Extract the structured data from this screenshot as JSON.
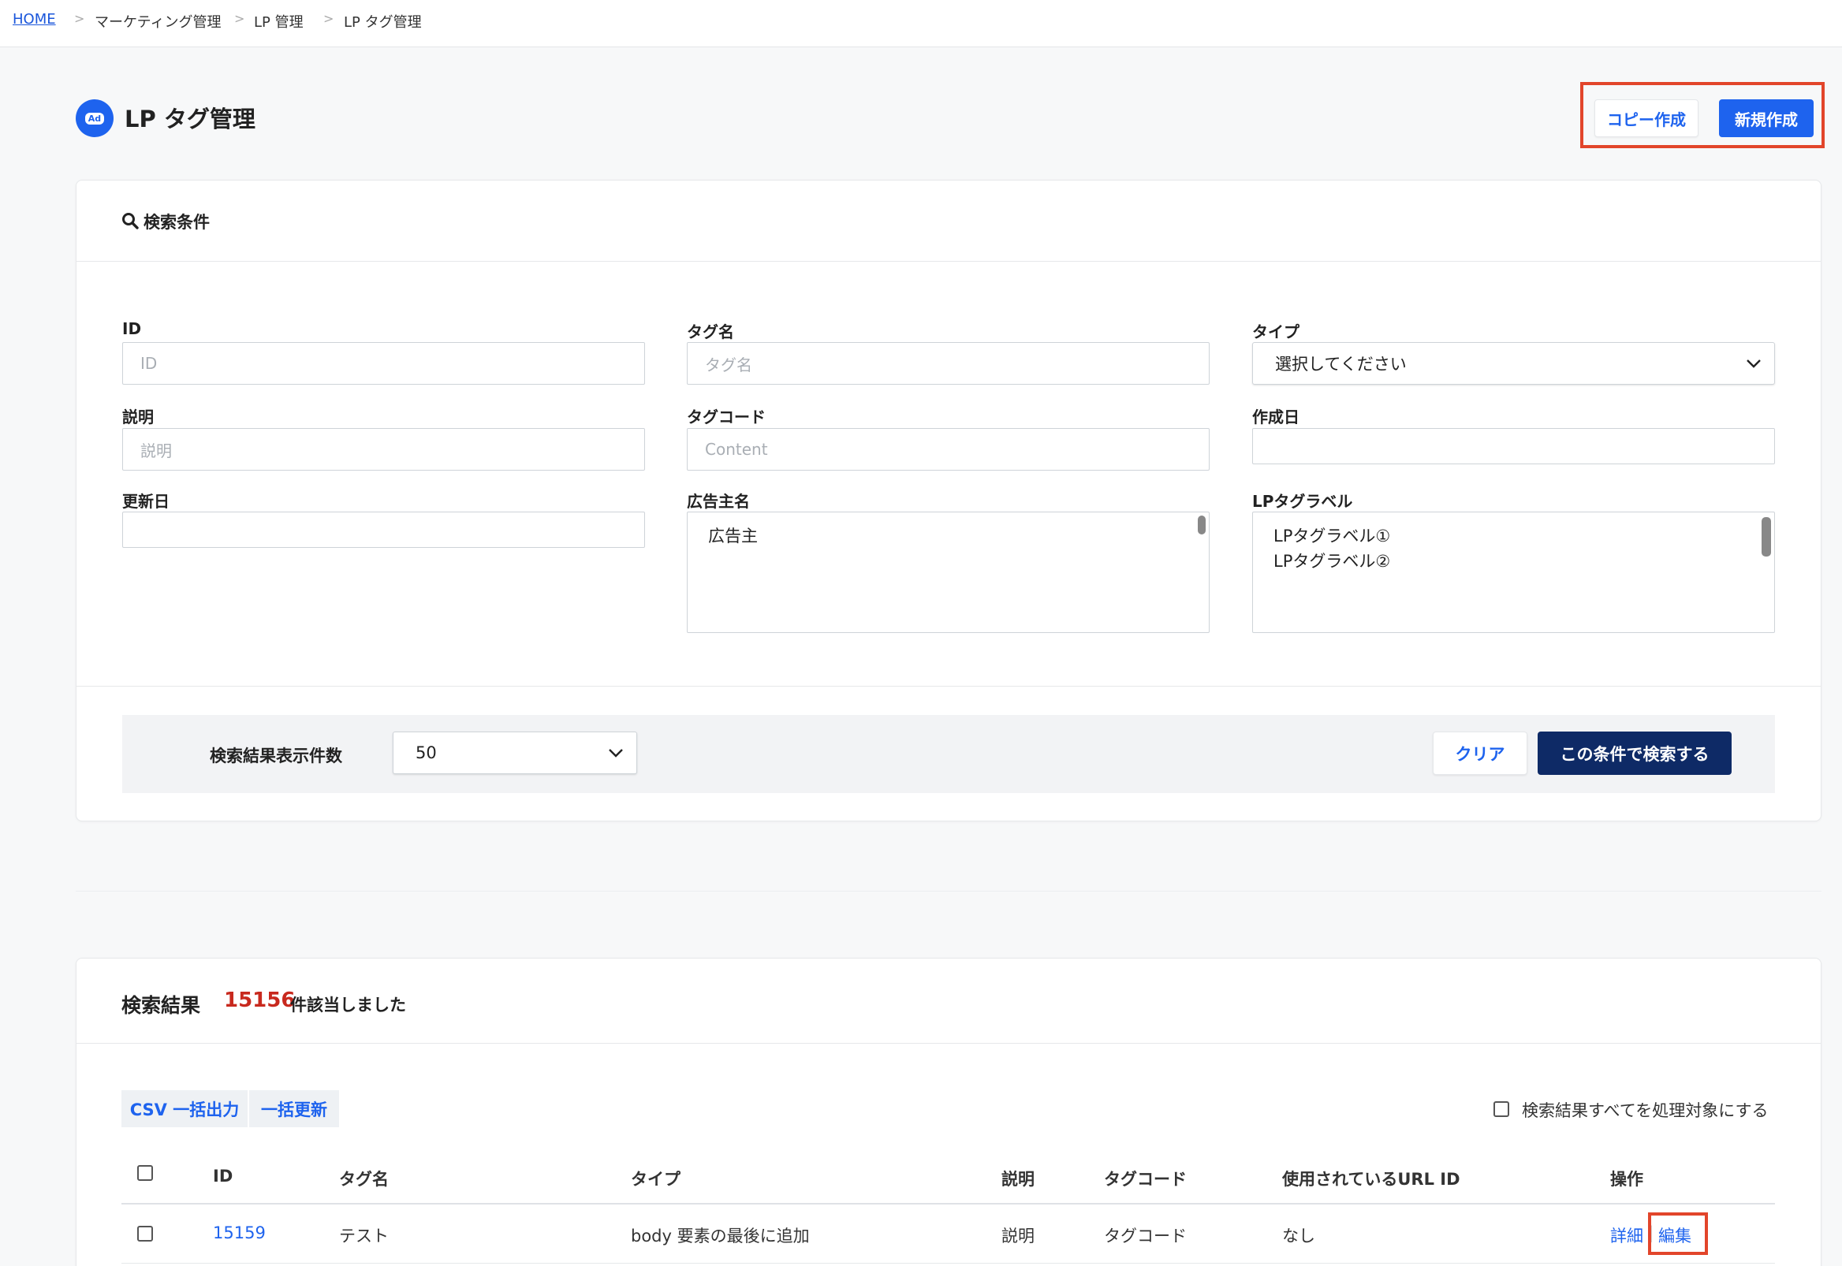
{
  "breadcrumb": {
    "home": "HOME",
    "sep": ">",
    "items": [
      "マーケティング管理",
      "LP 管理",
      "LP タグ管理"
    ]
  },
  "header": {
    "icon_text": "Ad",
    "title": "LP タグ管理",
    "copy_button": "コピー作成",
    "new_button": "新規作成"
  },
  "search": {
    "title": "検索条件",
    "fields": {
      "id": {
        "label": "ID",
        "placeholder": "ID"
      },
      "tag_name": {
        "label": "タグ名",
        "placeholder": "タグ名"
      },
      "type": {
        "label": "タイプ",
        "value": "選択してください"
      },
      "description": {
        "label": "説明",
        "placeholder": "説明"
      },
      "tag_code": {
        "label": "タグコード",
        "placeholder": "Content"
      },
      "created": {
        "label": "作成日",
        "value": ""
      },
      "updated": {
        "label": "更新日",
        "value": ""
      },
      "advertiser": {
        "label": "広告主名",
        "options": [
          "広告主"
        ]
      },
      "lp_label": {
        "label": "LPタグラベル",
        "options": [
          "LPタグラベル①",
          "LPタグラベル②"
        ]
      }
    },
    "page_size_label": "検索結果表示件数",
    "page_size_value": "50",
    "clear_button": "クリア",
    "search_button": "この条件で検索する"
  },
  "results": {
    "title": "検索結果",
    "count": "15156",
    "count_suffix": "件該当しました",
    "csv_button": "CSV 一括出力",
    "bulk_update_button": "一括更新",
    "select_all_label": "検索結果すべてを処理対象にする",
    "columns": [
      "ID",
      "タグ名",
      "タイプ",
      "説明",
      "タグコード",
      "使用されているURL ID",
      "操作"
    ],
    "rows": [
      {
        "id": "15159",
        "tag_name": "テスト",
        "type": "body 要素の最後に追加",
        "description": "説明",
        "tag_code": "タグコード",
        "url_id": "なし",
        "detail": "詳細",
        "sep": "|",
        "edit": "編集"
      }
    ]
  },
  "colors": {
    "primary": "#1e63ee",
    "navy": "#0e2a66",
    "highlight": "#e2452b",
    "count": "#c8291e"
  }
}
